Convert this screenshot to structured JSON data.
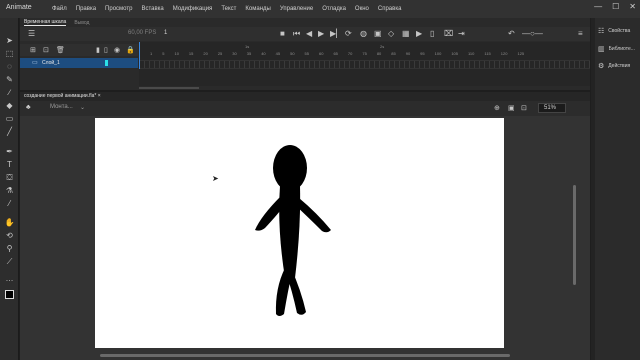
{
  "app": {
    "name": "Animate"
  },
  "menu": [
    "Файл",
    "Правка",
    "Просмотр",
    "Вставка",
    "Модификация",
    "Текст",
    "Команды",
    "Управление",
    "Отладка",
    "Окно",
    "Справка"
  ],
  "window_controls": {
    "minimize": "—",
    "maximize": "☐",
    "close": "✕"
  },
  "timeline": {
    "tabs": [
      "Временная шкала",
      "Вывод"
    ],
    "fps": "60,00 FPS",
    "current_frame": "1",
    "layer_name": "Слой_1",
    "ruler_marks": [
      "1",
      "5",
      "10",
      "15",
      "20",
      "25",
      "30",
      "35",
      "40",
      "45",
      "50",
      "55",
      "60",
      "65",
      "70",
      "75",
      "80",
      "85",
      "90",
      "95",
      "100",
      "105",
      "110",
      "115",
      "120",
      "125"
    ],
    "ruler_seconds": [
      "1s",
      "2s"
    ]
  },
  "document": {
    "tab_title": "создание первой анимации.fla*",
    "tab_close": "×",
    "scene_name": "Монта...",
    "zoom": "51%"
  },
  "right_panel": {
    "items": [
      {
        "label": "Свойства",
        "icon": "properties-icon"
      },
      {
        "label": "Библиоте...",
        "icon": "library-icon"
      },
      {
        "label": "Действия",
        "icon": "actions-icon"
      }
    ]
  },
  "colors": {
    "accent": "#3b88e0",
    "layer_selected": "#1d4d80",
    "stage": "#ffffff",
    "figure": "#000000"
  }
}
